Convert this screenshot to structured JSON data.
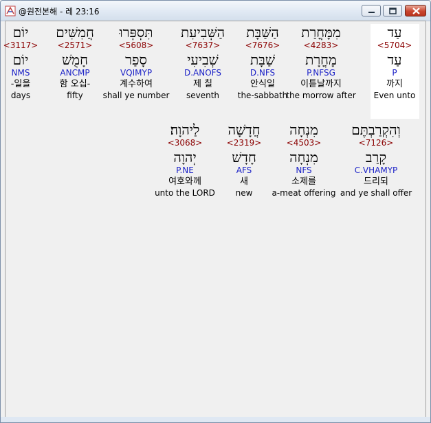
{
  "window": {
    "title": "@원전본해 - 레 23:16"
  },
  "rows": [
    {
      "words": [
        {
          "hebrew": "עַד",
          "strong": "<5704>",
          "lemma": "עַד",
          "parse": "P",
          "korean": "까지",
          "english": "Even unto",
          "selected": true
        },
        {
          "hebrew": "מִמָּחֳרַת",
          "strong": "<4283>",
          "lemma": "מָחֳרָת",
          "parse": "P.NFSG",
          "korean": "이튿날까지",
          "english": "the morrow after",
          "selected": false
        },
        {
          "hebrew": "הַשַּׁבָּת",
          "strong": "<7676>",
          "lemma": "שַׁבָּת",
          "parse": "D.NFS",
          "korean": "안식일",
          "english": "the-sabbath",
          "selected": false
        },
        {
          "hebrew": "הַשְּׁבִיעִת",
          "strong": "<7637>",
          "lemma": "שְׁבִיעִי",
          "parse": "D.ANOFS",
          "korean": "제 칠",
          "english": "seventh",
          "selected": false
        },
        {
          "hebrew": "תִּסְפְּרוּ",
          "strong": "<5608>",
          "lemma": "סָפַר",
          "parse": "VQIMYP",
          "korean": "계수하여",
          "english": "shall ye number",
          "selected": false
        },
        {
          "hebrew": "חֲמִשִּׁים",
          "strong": "<2571>",
          "lemma": "חָמֻשׁ",
          "parse": "ANCMP",
          "korean": "함 오십-",
          "english": "fifty",
          "selected": false
        },
        {
          "hebrew": "יוֹם",
          "strong": "<3117>",
          "lemma": "יוֹם",
          "parse": "NMS",
          "korean": "-일을",
          "english": "days",
          "selected": false
        }
      ]
    },
    {
      "words": [
        {
          "hebrew": "וְהִקְרַבְתֶּם",
          "strong": "<7126>",
          "lemma": "קָרַב",
          "parse": "C.VHAMYP",
          "korean": "드리되",
          "english": "and ye shall offer",
          "selected": false
        },
        {
          "hebrew": "מִנְחָה",
          "strong": "<4503>",
          "lemma": "מִנְחָה",
          "parse": "NFS",
          "korean": "소제를",
          "english": "a-meat offering",
          "selected": false
        },
        {
          "hebrew": "חֲדָשָׁה",
          "strong": "<2319>",
          "lemma": "חָדָשׁ",
          "parse": "AFS",
          "korean": "새",
          "english": "new",
          "selected": false
        },
        {
          "hebrew": "לַיהוָה׃",
          "strong": "<3068>",
          "lemma": "יְהוָה",
          "parse": "P.NE",
          "korean": "여호와께",
          "english": "unto the LORD",
          "selected": false
        }
      ]
    }
  ]
}
